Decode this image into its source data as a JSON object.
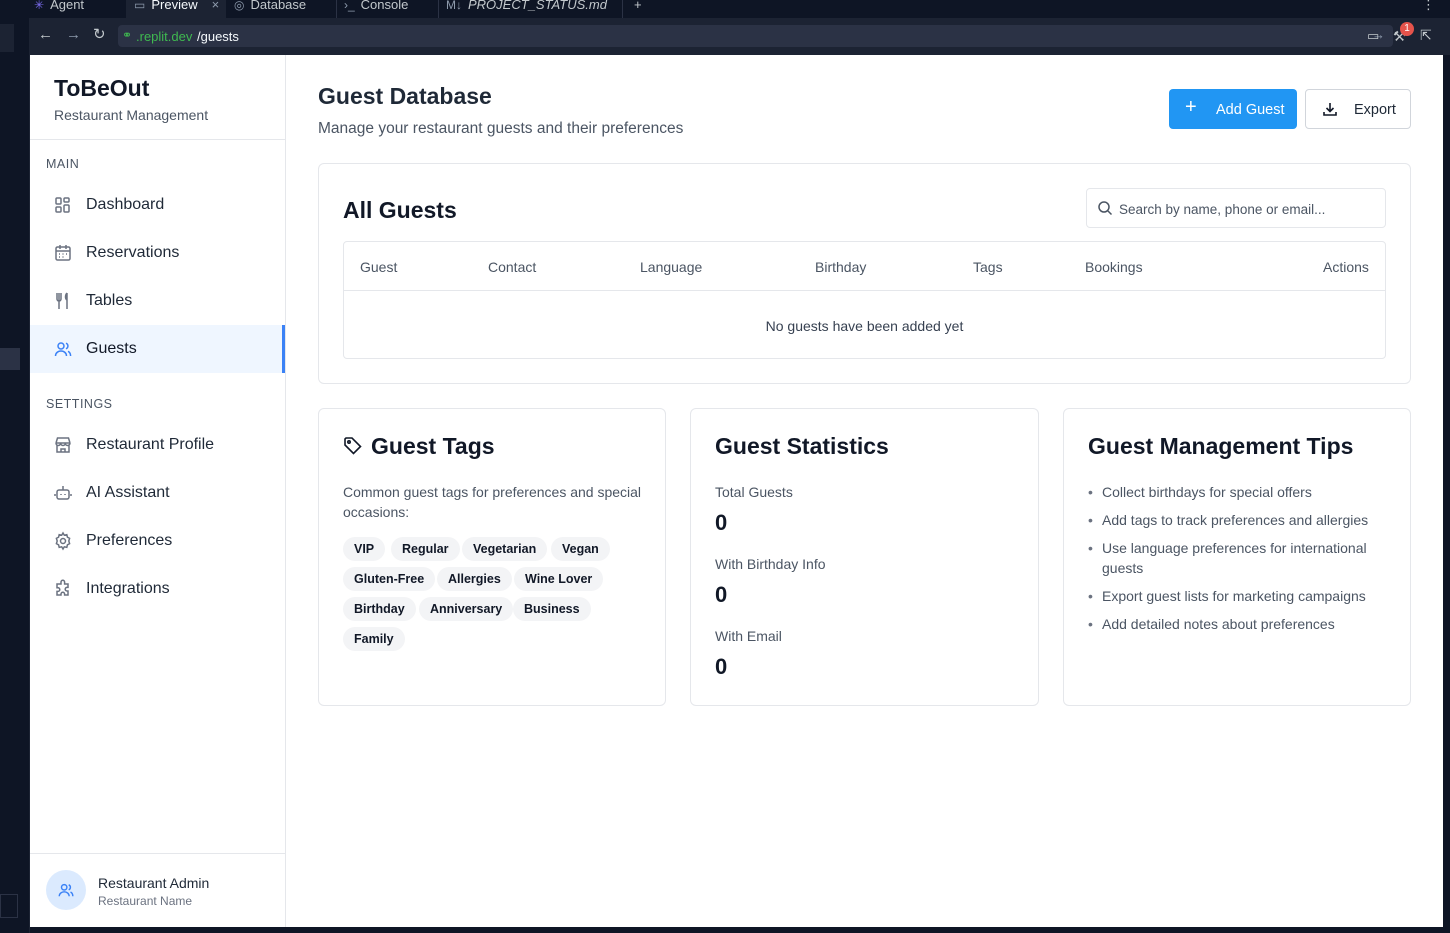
{
  "ide": {
    "tabs": [
      {
        "label": "Agent",
        "icon": "agent-icon"
      },
      {
        "label": "Preview",
        "icon": "monitor-icon"
      },
      {
        "label": "Database",
        "icon": "database-icon"
      },
      {
        "label": "Console",
        "icon": "terminal-icon"
      },
      {
        "label": "PROJECT_STATUS.md",
        "icon": "markdown-icon"
      }
    ],
    "close_glyph": "×",
    "new_tab_glyph": "+",
    "url_domain": ".replit.dev",
    "url_path": "/guests",
    "notification_count": "1"
  },
  "sidebar": {
    "brand": "ToBeOut",
    "brand_sub": "Restaurant Management",
    "main_heading": "MAIN",
    "settings_heading": "SETTINGS",
    "main_items": [
      {
        "label": "Dashboard",
        "icon": "dashboard-icon"
      },
      {
        "label": "Reservations",
        "icon": "calendar-icon"
      },
      {
        "label": "Tables",
        "icon": "utensils-icon"
      },
      {
        "label": "Guests",
        "icon": "users-icon",
        "active": true
      }
    ],
    "settings_items": [
      {
        "label": "Restaurant Profile",
        "icon": "store-icon"
      },
      {
        "label": "AI Assistant",
        "icon": "bot-icon"
      },
      {
        "label": "Preferences",
        "icon": "gear-icon"
      },
      {
        "label": "Integrations",
        "icon": "puzzle-icon"
      }
    ],
    "user": {
      "name": "Restaurant Admin",
      "sub": "Restaurant Name"
    }
  },
  "header": {
    "title": "Guest Database",
    "subtitle": "Manage your restaurant guests and their preferences",
    "add_label": "Add Guest",
    "export_label": "Export",
    "accent": "#2196f3"
  },
  "guests_table": {
    "title": "All Guests",
    "search_placeholder": "Search by name, phone or email...",
    "columns": [
      "Guest",
      "Contact",
      "Language",
      "Birthday",
      "Tags",
      "Bookings",
      "Actions"
    ],
    "empty_text": "No guests have been added yet"
  },
  "tags_card": {
    "title": "Guest Tags",
    "description": "Common guest tags for preferences and special occasions:",
    "tags": [
      "VIP",
      "Regular",
      "Vegetarian",
      "Vegan",
      "Gluten-Free",
      "Allergies",
      "Wine Lover",
      "Birthday",
      "Anniversary",
      "Business",
      "Family"
    ]
  },
  "stats_card": {
    "title": "Guest Statistics",
    "stats": [
      {
        "label": "Total Guests",
        "value": "0"
      },
      {
        "label": "With Birthday Info",
        "value": "0"
      },
      {
        "label": "With Email",
        "value": "0"
      }
    ]
  },
  "tips_card": {
    "title": "Guest Management Tips",
    "tips": [
      "Collect birthdays for special offers",
      "Add tags to track preferences and allergies",
      "Use language preferences for international guests",
      "Export guest lists for marketing campaigns",
      "Add detailed notes about preferences"
    ]
  }
}
